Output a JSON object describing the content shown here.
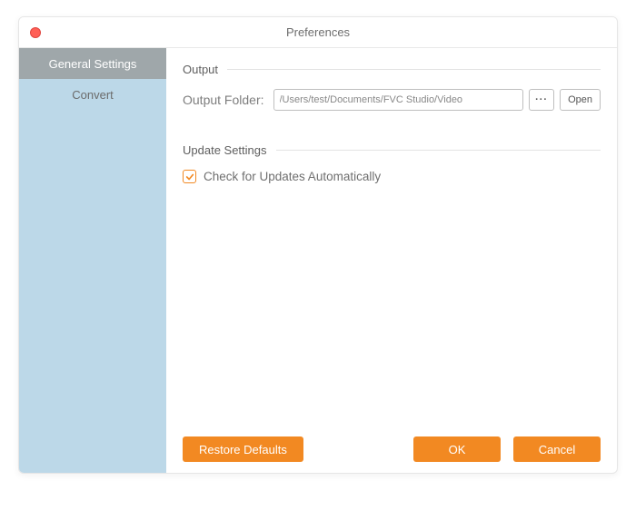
{
  "title": "Preferences",
  "sidebar": {
    "items": [
      {
        "label": "General Settings",
        "active": true
      },
      {
        "label": "Convert",
        "active": false
      }
    ]
  },
  "sections": {
    "output": {
      "heading": "Output",
      "folder_label": "Output Folder:",
      "folder_path": "/Users/test/Documents/FVC Studio/Video",
      "browse_label": "···",
      "open_label": "Open"
    },
    "update": {
      "heading": "Update Settings",
      "check_label": "Check for Updates Automatically",
      "checked": true
    }
  },
  "footer": {
    "restore_label": "Restore Defaults",
    "ok_label": "OK",
    "cancel_label": "Cancel"
  },
  "colors": {
    "accent": "#f28922",
    "sidebar_bg": "#bcd8e8",
    "sidebar_active": "#9fa7aa"
  }
}
